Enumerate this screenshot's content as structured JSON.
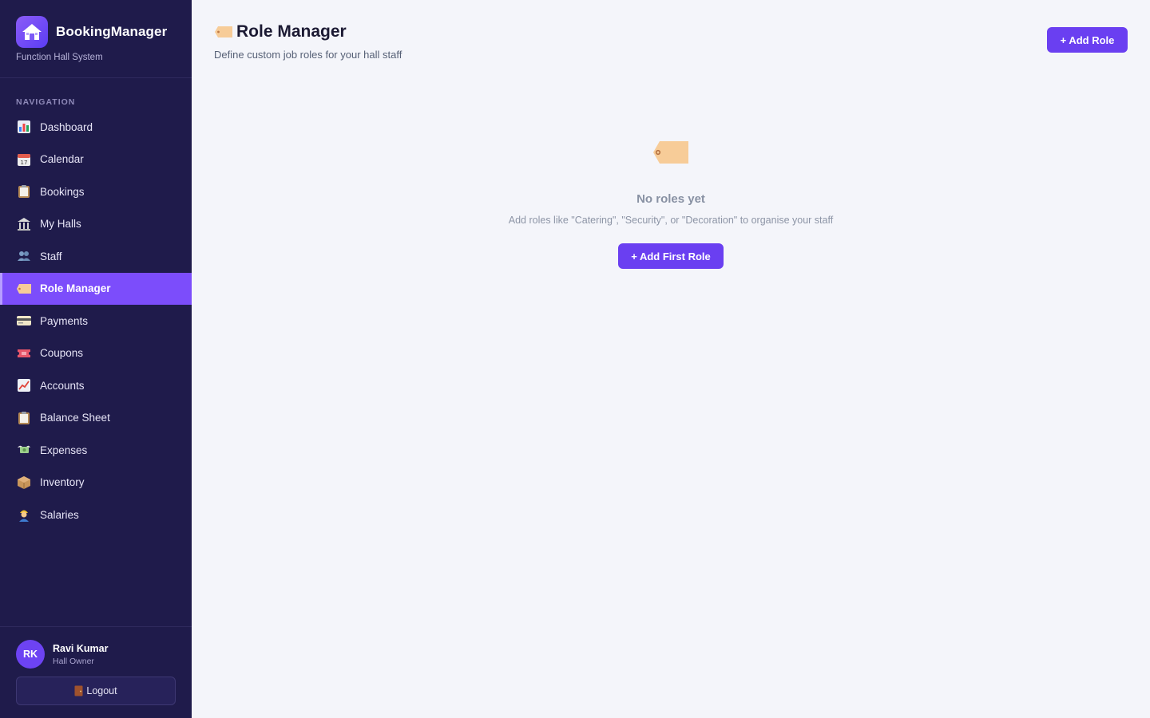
{
  "app": {
    "name": "BookingManager",
    "subtitle": "Function Hall System"
  },
  "sidebar": {
    "nav_title": "NAVIGATION",
    "items": [
      {
        "label": "Dashboard",
        "icon": "bar-chart-icon"
      },
      {
        "label": "Calendar",
        "icon": "calendar-icon"
      },
      {
        "label": "Bookings",
        "icon": "clipboard-icon"
      },
      {
        "label": "My Halls",
        "icon": "classical-building-icon"
      },
      {
        "label": "Staff",
        "icon": "people-icon"
      },
      {
        "label": "Role Manager",
        "icon": "tag-icon",
        "active": true
      },
      {
        "label": "Payments",
        "icon": "credit-card-icon"
      },
      {
        "label": "Coupons",
        "icon": "ticket-icon"
      },
      {
        "label": "Accounts",
        "icon": "trend-chart-icon"
      },
      {
        "label": "Balance Sheet",
        "icon": "clipboard-icon"
      },
      {
        "label": "Expenses",
        "icon": "flying-money-icon"
      },
      {
        "label": "Inventory",
        "icon": "package-icon"
      },
      {
        "label": "Salaries",
        "icon": "worker-icon"
      }
    ]
  },
  "user": {
    "initials": "RK",
    "name": "Ravi Kumar",
    "role": "Hall Owner",
    "logout_label": "Logout"
  },
  "page": {
    "title": "Role Manager",
    "subtitle": "Define custom job roles for your hall staff",
    "add_button": "+ Add Role"
  },
  "empty_state": {
    "icon": "tag-icon",
    "title": "No roles yet",
    "description": "Add roles like \"Catering\", \"Security\", or \"Decoration\" to organise your staff",
    "button": "+ Add First Role"
  },
  "colors": {
    "sidebar_bg": "#1f1b4b",
    "accent": "#6a3ff1",
    "active_item": "#7c4dfb",
    "page_bg": "#f4f5fa"
  }
}
